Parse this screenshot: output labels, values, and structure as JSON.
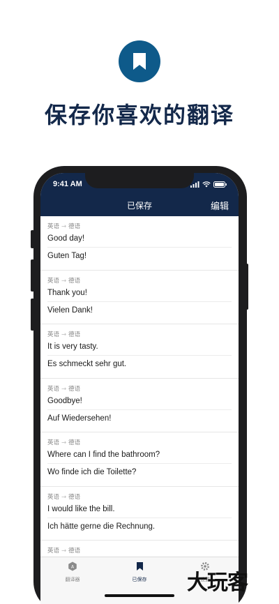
{
  "hero": {
    "title": "保存你喜欢的翻译",
    "icon": "bookmark-icon"
  },
  "status": {
    "time": "9:41 AM"
  },
  "nav": {
    "title": "已保存",
    "edit": "编辑"
  },
  "entries": [
    {
      "from": "英语",
      "to": "德语",
      "source": "Good day!",
      "translation": "Guten Tag!"
    },
    {
      "from": "英语",
      "to": "德语",
      "source": "Thank you!",
      "translation": "Vielen Dank!"
    },
    {
      "from": "英语",
      "to": "德语",
      "source": "It is very tasty.",
      "translation": "Es schmeckt sehr gut."
    },
    {
      "from": "英语",
      "to": "德语",
      "source": "Goodbye!",
      "translation": "Auf Wiedersehen!"
    },
    {
      "from": "英语",
      "to": "德语",
      "source": "Where can I find the bathroom?",
      "translation": "Wo finde ich die Toilette?"
    },
    {
      "from": "英语",
      "to": "德语",
      "source": "I would like the bill.",
      "translation": "Ich hätte gerne die Rechnung."
    },
    {
      "from": "英语",
      "to": "德语",
      "source": "",
      "translation": ""
    }
  ],
  "tabs": [
    {
      "label": "翻译器",
      "icon": "translator-icon"
    },
    {
      "label": "已保存",
      "icon": "bookmark-icon"
    },
    {
      "label": "设置",
      "icon": "gear-icon"
    }
  ],
  "watermark": "大玩客",
  "colors": {
    "navy": "#13284a",
    "brand_blue": "#0e5a8a"
  }
}
